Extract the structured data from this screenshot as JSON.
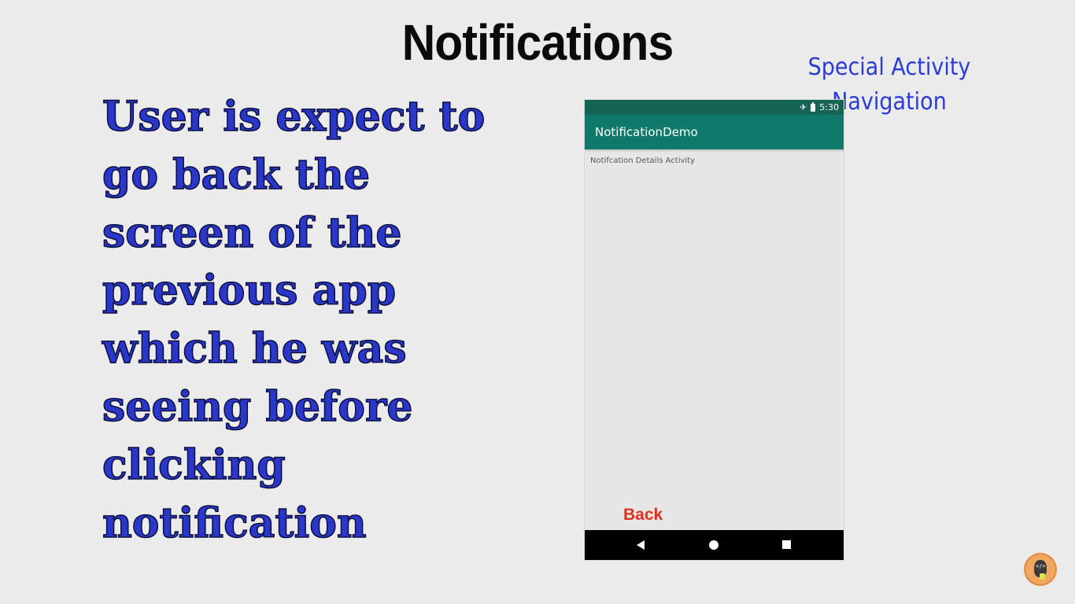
{
  "slide": {
    "title": "Notifications",
    "subtitle": "Special Activity Navigation",
    "body": "User is expect to\ngo back the\nscreen of the\nprevious app\nwhich he was\nseeing before\nclicking\nnotification"
  },
  "phone": {
    "status_time": "5:30",
    "app_title": "NotificationDemo",
    "content_text": "Notifcation Details Activity",
    "back_label": "Back",
    "colors": {
      "status_bar": "#166456",
      "app_bar": "#0f7a6b",
      "back_label": "#e03020"
    },
    "icons": [
      "airplane-icon",
      "battery-icon",
      "nav-back-icon",
      "nav-home-icon",
      "nav-recent-icon"
    ]
  },
  "colors": {
    "background": "#ebebeb",
    "title": "#0a0a0a",
    "subtitle": "#2c3bd6",
    "body": "#2a37c8"
  }
}
